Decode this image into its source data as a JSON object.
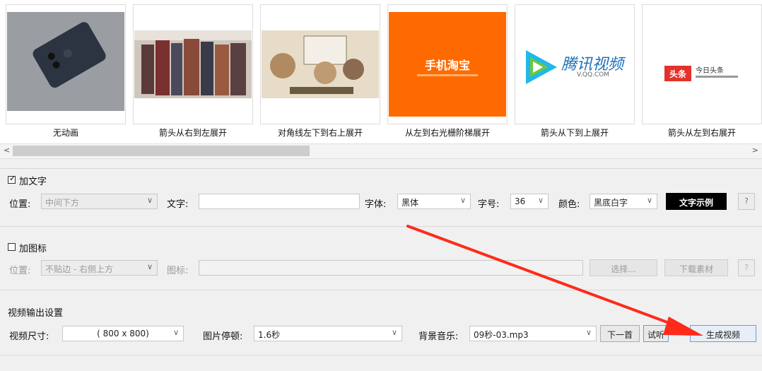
{
  "colors": {
    "arrow": "#ff2a1a",
    "text_sample_bg": "#000000",
    "taobao": "#ff6a00"
  },
  "thumbnails": [
    {
      "caption": "无动画",
      "image": "phone-photo"
    },
    {
      "caption": "箭头从右到左展开",
      "image": "anime-group-illustration"
    },
    {
      "caption": "对角线左下到右上展开",
      "image": "anime-illustration"
    },
    {
      "caption": "从左到右光栅阶梯展开",
      "image": "taobao-logo",
      "image_text": "手机淘宝"
    },
    {
      "caption": "箭头从下到上展开",
      "image": "tencent-video-logo",
      "image_text": "腾讯视频",
      "image_sub": "V.QQ.COM"
    },
    {
      "caption": "箭头从左到右展开",
      "image": "toutiao-logo",
      "image_text": "头条",
      "image_side": "今日头条"
    }
  ],
  "text_section": {
    "checkbox_label": "加文字",
    "position_label": "位置:",
    "position_value": "中间下方",
    "text_label": "文字:",
    "text_value": "",
    "font_label": "字体:",
    "font_value": "黑体",
    "size_label": "字号:",
    "size_value": "36",
    "color_label": "颜色:",
    "color_value": "黑底白字",
    "sample_button": "文字示例",
    "help": "?"
  },
  "icon_section": {
    "checkbox_label": "加图标",
    "position_label": "位置:",
    "position_value": "不贴边 - 右侧上方",
    "icon_label": "图标:",
    "icon_value": "",
    "select_button": "选择...",
    "download_button": "下载素材",
    "help": "?"
  },
  "output_section": {
    "title": "视频输出设置",
    "size_label": "视频尺寸:",
    "size_value": "( 800 x 800)",
    "pause_label": "图片停顿:",
    "pause_value": "1.6秒",
    "music_label": "背景音乐:",
    "music_value": "09秒-03.mp3",
    "next_button": "下一首",
    "listen_button": "试听",
    "generate_button": "生成视频"
  }
}
